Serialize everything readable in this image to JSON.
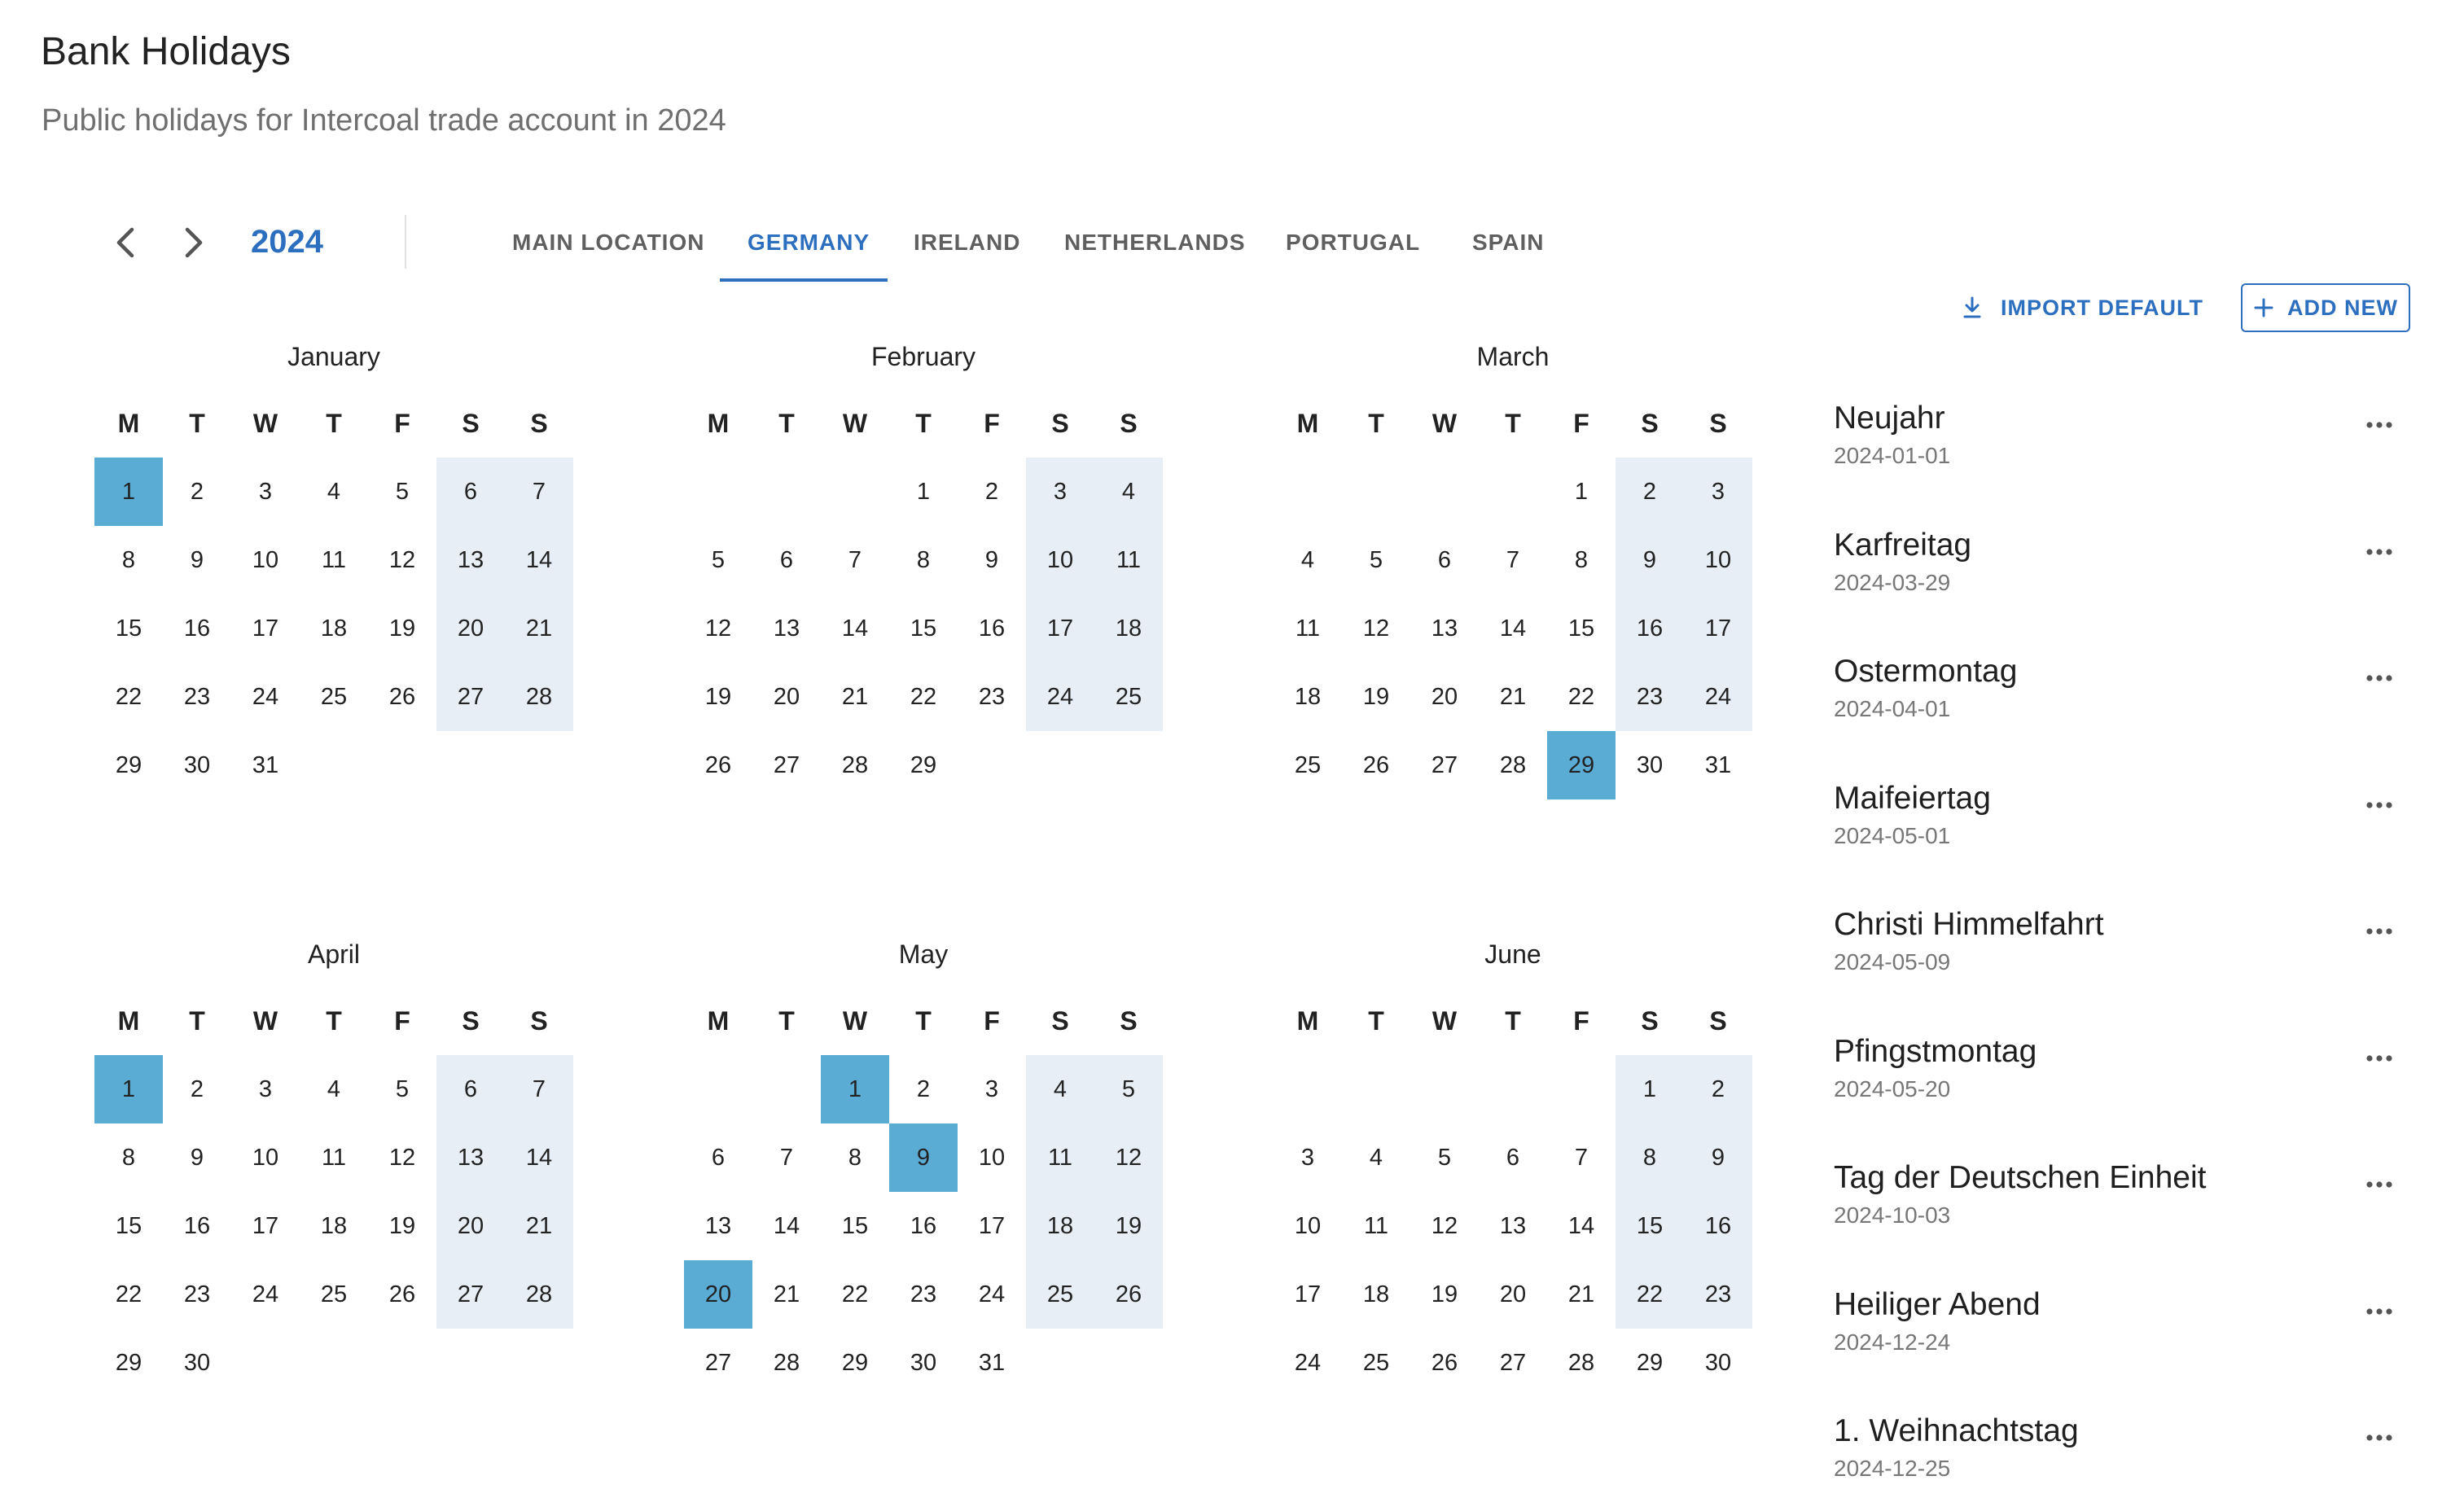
{
  "page": {
    "title": "Bank Holidays",
    "subtitle": "Public holidays for Intercoal trade account in 2024"
  },
  "toolbar": {
    "prev_icon": "chevron-left-icon",
    "next_icon": "chevron-right-icon",
    "year": "2024",
    "tabs": [
      {
        "label": "MAIN LOCATION",
        "active": false
      },
      {
        "label": "GERMANY",
        "active": true
      },
      {
        "label": "IRELAND",
        "active": false
      },
      {
        "label": "NETHERLANDS",
        "active": false
      },
      {
        "label": "PORTUGAL",
        "active": false
      },
      {
        "label": "SPAIN",
        "active": false
      }
    ],
    "import_label": "IMPORT DEFAULT",
    "add_label": "ADD NEW",
    "accent_color": "#2d6fbf"
  },
  "calendar": {
    "weekdays": [
      "M",
      "T",
      "W",
      "T",
      "F",
      "S",
      "S"
    ],
    "weekend_color": "#e8eef6",
    "holiday_color": "#5aacd5",
    "months": [
      {
        "name": "January",
        "first_weekday": 0,
        "days": 31,
        "holidays": [
          1
        ]
      },
      {
        "name": "February",
        "first_weekday": 3,
        "days": 29,
        "holidays": []
      },
      {
        "name": "March",
        "first_weekday": 4,
        "days": 31,
        "holidays": [
          29
        ]
      },
      {
        "name": "April",
        "first_weekday": 0,
        "days": 30,
        "holidays": [
          1
        ]
      },
      {
        "name": "May",
        "first_weekday": 2,
        "days": 31,
        "holidays": [
          1,
          9,
          20
        ]
      },
      {
        "name": "June",
        "first_weekday": 5,
        "days": 30,
        "holidays": []
      }
    ]
  },
  "holidays": [
    {
      "name": "Neujahr",
      "date": "2024-01-01"
    },
    {
      "name": "Karfreitag",
      "date": "2024-03-29"
    },
    {
      "name": "Ostermontag",
      "date": "2024-04-01"
    },
    {
      "name": "Maifeiertag",
      "date": "2024-05-01"
    },
    {
      "name": "Christi Himmelfahrt",
      "date": "2024-05-09"
    },
    {
      "name": "Pfingstmontag",
      "date": "2024-05-20"
    },
    {
      "name": "Tag der Deutschen Einheit",
      "date": "2024-10-03"
    },
    {
      "name": "Heiliger Abend",
      "date": "2024-12-24"
    },
    {
      "name": "1. Weihnachtstag",
      "date": "2024-12-25"
    }
  ]
}
